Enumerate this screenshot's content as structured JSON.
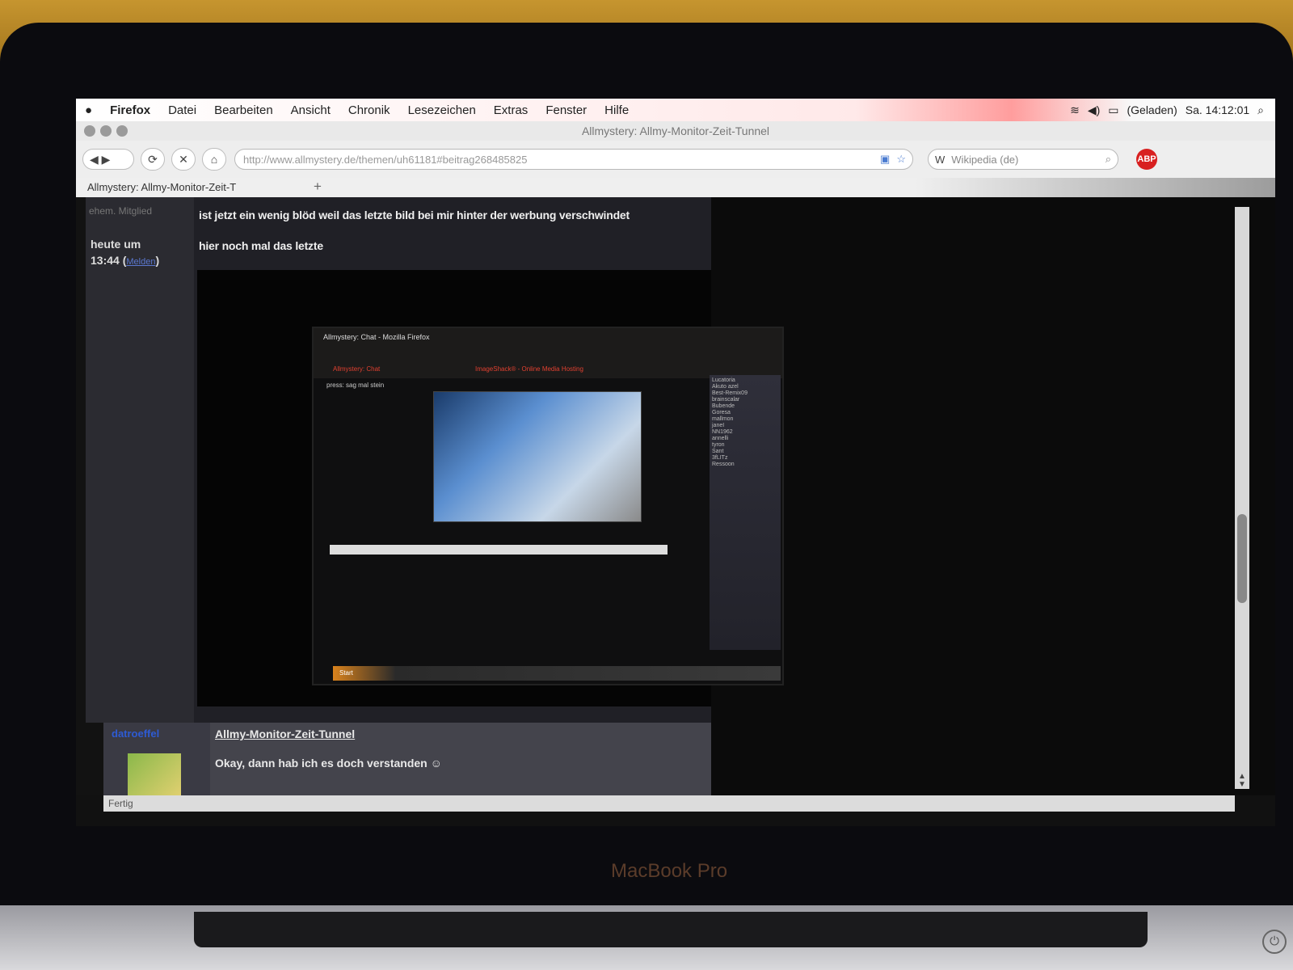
{
  "menubar": {
    "app": "Firefox",
    "items": [
      "Datei",
      "Bearbeiten",
      "Ansicht",
      "Chronik",
      "Lesezeichen",
      "Extras",
      "Fenster",
      "Hilfe"
    ],
    "battery": "(Geladen)",
    "clock": "Sa. 14:12:01"
  },
  "window": {
    "title": "Allmystery: Allmy-Monitor-Zeit-Tunnel"
  },
  "navbar": {
    "url": "http://www.allmystery.de/themen/uh61181#beitrag2684858​25",
    "search_placeholder": "Wikipedia (de)",
    "search_engine": "W",
    "adblock": "ABP"
  },
  "tab": {
    "label": "Allmystery: Allmy-Monitor-Zeit-T",
    "new_tab": "+"
  },
  "post": {
    "author_role": "ehem. Mitglied",
    "time_prefix": "heute um",
    "time": "13:44",
    "time_link": "Melden",
    "line1": "ist jetzt ein wenig blöd weil das letzte bild bei mir hinter der werbung verschwindet",
    "line2": "hier noch mal das letzte"
  },
  "inner_photo": {
    "window_title": "Allmystery: Chat - Mozilla Firefox",
    "tab1": "Allmystery: Chat",
    "tab2": "ImageShack® - Online Media Hosting",
    "chat_line": "press: sag mal stein",
    "userlist": [
      "Lucatoria",
      "Akuto azel",
      "Best-Remix09",
      "brainscalar",
      "Bubende",
      "Goresa",
      "mallmon",
      "janeI",
      "NN1962",
      "annelli",
      "tyron",
      "Sant",
      "3fLITz",
      "Ressoon"
    ],
    "taskbar": "Start"
  },
  "next_post": {
    "author": "datroeffel",
    "title": "Allmy-Monitor-Zeit-Tunnel",
    "text": "Okay, dann hab ich es doch verstanden ☺"
  },
  "statusbar": {
    "text": "Fertig"
  },
  "device": {
    "brand": "MacBook Pro"
  },
  "colors": {
    "accent_red": "#ff9d9d",
    "link_blue": "#2e5bd4"
  }
}
